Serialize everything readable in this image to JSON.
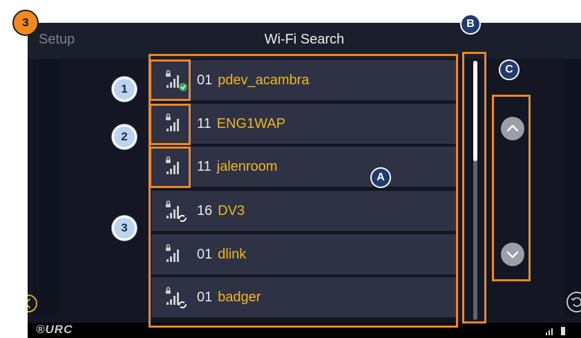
{
  "header": {
    "back_label": "Setup",
    "title": "Wi-Fi Search"
  },
  "networks": [
    {
      "channel": "01",
      "ssid": "pdev_acambra",
      "status": "connected"
    },
    {
      "channel": "11",
      "ssid": "ENG1WAP",
      "status": "locked"
    },
    {
      "channel": "11",
      "ssid": "jalenroom",
      "status": "locked"
    },
    {
      "channel": "16",
      "ssid": "DV3",
      "status": "locked-refresh"
    },
    {
      "channel": "01",
      "ssid": "dlink",
      "status": "locked"
    },
    {
      "channel": "01",
      "ssid": "badger",
      "status": "locked-refresh"
    }
  ],
  "annotations": {
    "corner": "3",
    "circled": [
      "1",
      "2",
      "3"
    ],
    "lettered": [
      "A",
      "B",
      "C"
    ]
  },
  "footer": {
    "logo": "®URC"
  },
  "colors": {
    "accent": "#f08a1f",
    "ssid": "#f2b61d",
    "row": "#2e3244",
    "screen": "#141723"
  }
}
